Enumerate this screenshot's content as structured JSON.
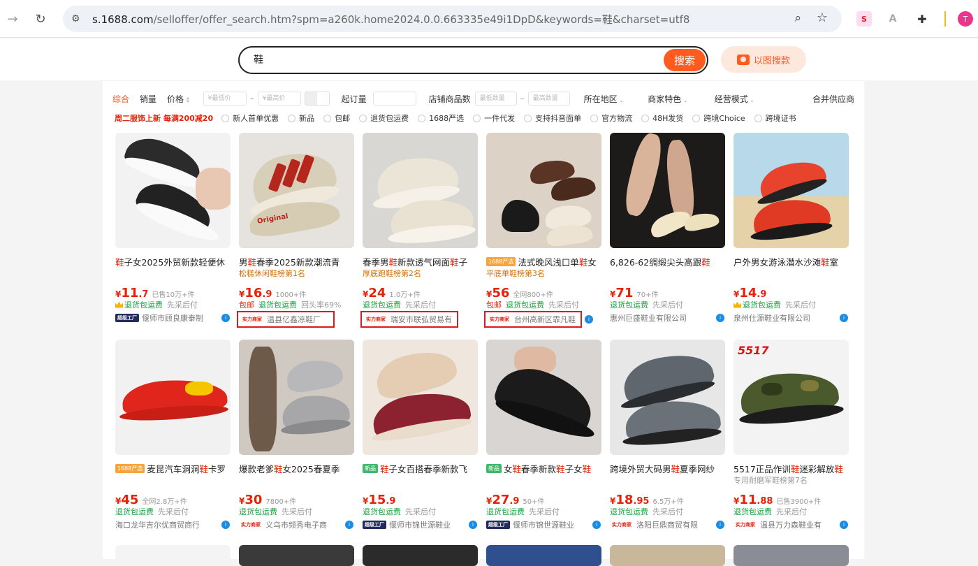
{
  "browser": {
    "url_host": "s.1688.com",
    "url_path": "/selloffer/offer_search.htm?spm=a260k.home2024.0.0.663335e49i1DpD&keywords=鞋&charset=utf8",
    "ext_seo": "S",
    "ext_a": "A",
    "avatar_letter": "T"
  },
  "search": {
    "query": "鞋",
    "button": "搜索",
    "image_search": "以图搜款"
  },
  "filters": {
    "sort_all": "综合",
    "sales": "销量",
    "price": "价格",
    "min_price": "¥最低价",
    "max_price": "¥最高价",
    "moq": "起订量",
    "shop_count": "店铺商品数",
    "min_count": "最低数量",
    "max_count": "最高数量",
    "region": "所在地区",
    "feature": "商家特色",
    "mode": "经营模式",
    "merge": "合并供应商"
  },
  "tags": {
    "promo": "周二服饰上新 每满200减20",
    "items": [
      "新人首单优惠",
      "新品",
      "包邮",
      "退货包运费",
      "1688严选",
      "一件代发",
      "支持抖音面单",
      "官方物流",
      "48H发货",
      "跨境Choice",
      "跨境证书"
    ]
  },
  "products": [
    {
      "title_pre": "",
      "title_hl": "鞋",
      "title_post": "子女2025外贸新款轻便休",
      "badge": "",
      "sub": "",
      "price_int": "11",
      "price_dec": ".7",
      "sold": "已售10万+件",
      "svc1": "退货包运费",
      "svc1_color": "green",
      "svc2": "先采后付",
      "crown": true,
      "seller_tag": "超级工厂",
      "seller": "偃师市顾良康泰制",
      "boxed": false
    },
    {
      "title_pre": "男",
      "title_hl": "鞋",
      "title_post": "春季2025新款潮流青",
      "badge": "",
      "sub": "松糕休闲鞋榜第1名",
      "price_int": "16",
      "price_dec": ".9",
      "sold": "1000+件",
      "svc0": "包邮",
      "svc1": "退货包运费",
      "svc2": "回头率69%",
      "crown": false,
      "seller_tag": "实力商家",
      "seller": "温县亿鑫凉鞋厂",
      "boxed": true
    },
    {
      "title_pre": "春季男",
      "title_hl": "鞋",
      "title_post": "新款透气网面",
      "title_post2": "子",
      "badge": "",
      "sub": "厚底跑鞋榜第2名",
      "price_int": "24",
      "price_dec": "",
      "sold": "1.0万+件",
      "svc1": "退货包运费",
      "svc2": "先采后付",
      "crown": false,
      "seller_tag": "实力商家",
      "seller": "瑞安市联弘贸易有",
      "boxed": true
    },
    {
      "title_pre": "法式晚风浅口单",
      "title_hl": "鞋",
      "title_post": "女",
      "badge": "1688严选",
      "sub": "平底单鞋榜第3名",
      "price_int": "56",
      "price_dec": "",
      "sold": "全网800+件",
      "svc0": "包邮",
      "svc1": "退货包运费",
      "svc2": "先采后付",
      "crown": false,
      "seller_tag": "实力商家",
      "seller": "台州高新区霏凡鞋",
      "boxed": true
    },
    {
      "title_pre": "6,826-62绸缎尖头高跟",
      "title_hl": "鞋",
      "title_post": "",
      "badge": "",
      "sub": "",
      "price_int": "71",
      "price_dec": "",
      "sold": "70+件",
      "svc1": "退货包运费",
      "svc2": "先采后付",
      "crown": false,
      "seller_tag": "",
      "seller": "惠州巨盛鞋业有限公司",
      "boxed": false
    },
    {
      "title_pre": "户外男女游泳潜水沙滩",
      "title_hl": "鞋",
      "title_post": "室",
      "badge": "",
      "sub": "",
      "price_int": "14",
      "price_dec": ".9",
      "sold": "",
      "svc1": "退货包运费",
      "svc2": "先采后付",
      "crown": true,
      "seller_tag": "",
      "seller": "泉州仕源鞋业有限公司",
      "boxed": false
    },
    {
      "title_pre": "麦昆汽车洞洞",
      "title_hl": "鞋",
      "title_post": "卡罗",
      "badge": "1688严选",
      "sub": "",
      "price_int": "45",
      "price_dec": "",
      "sold": "全网2.8万+件",
      "svc1": "退货包运费",
      "svc2": "先采后付",
      "crown": false,
      "seller_tag": "",
      "seller": "海口龙华吉尔优商贸商行",
      "boxed": false
    },
    {
      "title_pre": "爆款老爹",
      "title_hl": "鞋",
      "title_post": "女2025春夏季",
      "badge": "",
      "sub": "",
      "price_int": "30",
      "price_dec": "",
      "sold": "7800+件",
      "svc1": "退货包运费",
      "svc2": "先采后付",
      "crown": false,
      "seller_tag": "实力商家",
      "seller": "义乌市频秀电子商",
      "boxed": false
    },
    {
      "title_pre": "",
      "title_hl": "鞋",
      "title_post": "子女百搭春季新款飞",
      "badge": "新品",
      "sub": "",
      "price_int": "15",
      "price_dec": ".9",
      "sold": "",
      "svc1": "退货包运费",
      "svc2": "先采后付",
      "crown": false,
      "seller_tag": "超级工厂",
      "seller": "偃师市锦世源鞋业",
      "boxed": false
    },
    {
      "title_pre": "女",
      "title_hl": "鞋",
      "title_post": "春季新款",
      "title_hl2": "鞋",
      "title_post2": "子女",
      "title_hl3": "鞋",
      "badge": "新品",
      "sub": "",
      "price_int": "27",
      "price_dec": ".9",
      "sold": "50+件",
      "svc1": "退货包运费",
      "svc2": "先采后付",
      "crown": false,
      "seller_tag": "超级工厂",
      "seller": "偃师市锦世源鞋业",
      "boxed": false
    },
    {
      "title_pre": "跨境外贸大码男",
      "title_hl": "鞋",
      "title_post": "夏季网纱",
      "badge": "",
      "sub": "",
      "price_int": "18",
      "price_dec": ".95",
      "sold": "6.5万+件",
      "svc1": "退货包运费",
      "svc2": "先采后付",
      "crown": false,
      "seller_tag": "实力商家",
      "seller": "洛阳巨鼎商贸有限",
      "boxed": false
    },
    {
      "title_pre": "5517正品作训",
      "title_hl": "鞋",
      "title_post": "迷彩解放",
      "title_hl2": "鞋",
      "badge": "",
      "sub": "专用耐磨军鞋榜第7名",
      "price_int": "11",
      "price_dec": ".88",
      "sold": "已售3900+件",
      "svc1": "退货包运费",
      "svc2": "先采后付",
      "crown": false,
      "seller_tag": "实力商家",
      "seller": "温县万力森鞋业有",
      "boxed": false
    }
  ],
  "image_text": {
    "shoe_text": "Original",
    "brand_5517": "5517"
  },
  "colors": {
    "accent": "#ff5a1f",
    "price_red": "#e4230a",
    "service_green": "#1aa33f",
    "highlight_box": "#e01a1a"
  }
}
